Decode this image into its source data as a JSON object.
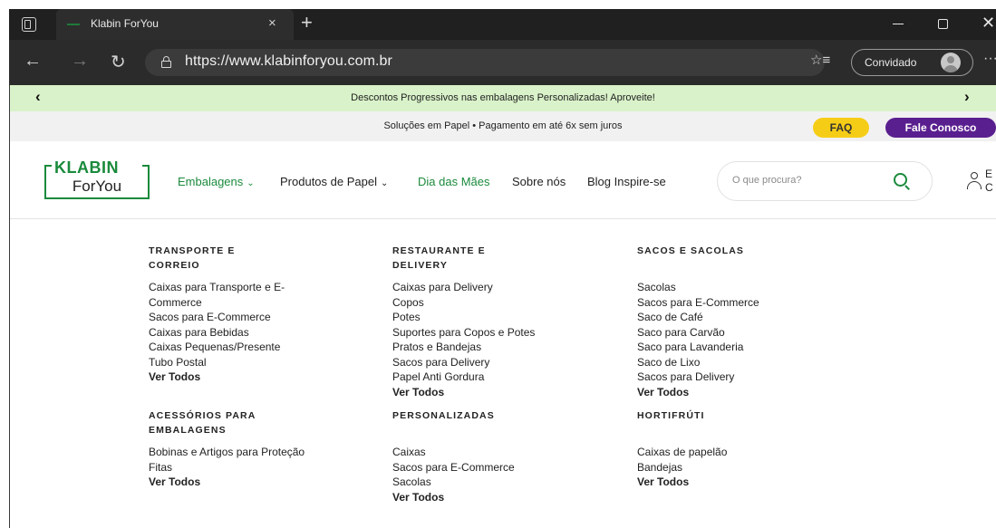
{
  "browser": {
    "tab_title": "Klabin ForYou",
    "tab_close_icon": "×",
    "new_tab_icon": "+",
    "url": "https://www.klabinforyou.com.br",
    "profile_label": "Convidado",
    "more_icon": "···",
    "back_icon": "←",
    "forward_icon": "→",
    "refresh_icon": "↻",
    "favorites_icon": "☆≡",
    "close_window_icon": "✕"
  },
  "promo": {
    "text": "Descontos Progressivos nas embalagens Personalizadas! Aproveite!",
    "prev_icon": "‹",
    "next_icon": "›"
  },
  "info": {
    "text": "Soluções em Papel • Pagamento em até 6x sem juros",
    "faq_label": "FAQ",
    "contact_label": "Fale Conosco"
  },
  "header": {
    "logo_top": "KLABIN",
    "logo_bottom": "ForYou",
    "nav": [
      {
        "label": "Embalagens"
      },
      {
        "label": "Produtos de Papel"
      },
      {
        "label": "Dia das Mães"
      },
      {
        "label": "Sobre nós"
      },
      {
        "label": "Blog Inspire-se"
      }
    ],
    "chevron": "⌄",
    "search_placeholder": "O que procura?",
    "user_text": "E C"
  },
  "menu": {
    "columns": [
      {
        "heading": "TRANSPORTE E CORREIO",
        "items": [
          "Caixas para Transporte e E-Commerce",
          "Sacos para E-Commerce",
          "Caixas para Bebidas",
          "Caixas Pequenas/Presente",
          "Tubo Postal"
        ],
        "see_all": "Ver Todos"
      },
      {
        "heading": "RESTAURANTE E DELIVERY",
        "items": [
          "Caixas para Delivery",
          "Copos",
          "Potes",
          "Suportes para Copos e Potes",
          "Pratos e Bandejas",
          "Sacos para Delivery",
          "Papel Anti Gordura"
        ],
        "see_all": "Ver Todos"
      },
      {
        "heading": "SACOS E SACOLAS",
        "items": [
          "Sacolas",
          "Sacos para E-Commerce",
          "Saco de Café",
          "Saco para Carvão",
          "Saco para Lavanderia",
          "Saco de Lixo",
          "Sacos para Delivery"
        ],
        "see_all": "Ver Todos"
      },
      {
        "heading": "ACESSÓRIOS PARA EMBALAGENS",
        "items": [
          "Bobinas e Artigos para Proteção",
          "Fitas"
        ],
        "see_all": "Ver Todos"
      },
      {
        "heading": "PERSONALIZADAS",
        "items": [
          "Caixas",
          "Sacos para E-Commerce",
          "Sacolas"
        ],
        "see_all": "Ver Todos"
      },
      {
        "heading": "HORTIFRÚTI",
        "items": [
          "Caixas de papelão",
          "Bandejas"
        ],
        "see_all": "Ver Todos"
      }
    ]
  },
  "colors": {
    "brand_green": "#1a8a3c",
    "promo_bg": "#d9f2c9",
    "faq_yellow": "#f6cd16",
    "contact_purple": "#5a1f8f"
  }
}
